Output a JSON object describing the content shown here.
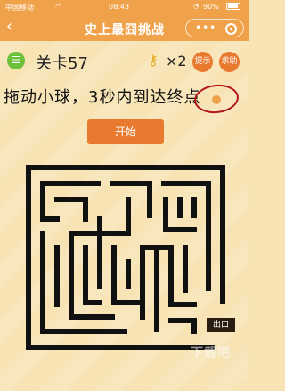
{
  "status_bar": {
    "carrier": "中国移动",
    "time": "08:43",
    "battery_text": "90%"
  },
  "nav": {
    "title": "史上最囧挑战",
    "back_icon": "chevron-left-icon"
  },
  "game": {
    "level_label": "关卡57",
    "key_count": "×2",
    "hint_label": "提示",
    "help_label": "求助",
    "instruction": "拖动小球，3秒内到达终点",
    "start_label": "开始",
    "exit_label": "出口",
    "watermark": "下载吧",
    "colors": {
      "accent": "#f0a24a",
      "button": "#e8792e",
      "menu_button": "#6abf3b",
      "background": "#f7e3b4",
      "maze_wall": "#111111",
      "annotation": "#b3161b"
    }
  }
}
